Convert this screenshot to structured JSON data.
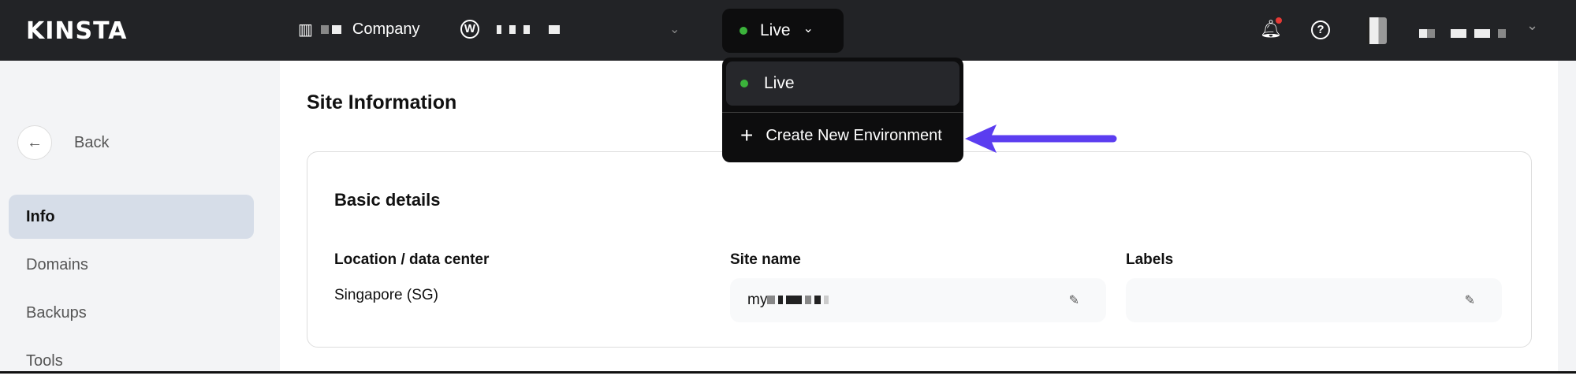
{
  "header": {
    "logo": "KINSTA",
    "company": "Company",
    "live_label": "Live",
    "user_menu_chevron": "⌄"
  },
  "dropdown": {
    "live": "Live",
    "create": "Create New Environment"
  },
  "sidebar": {
    "back": "Back",
    "items": [
      {
        "label": "Info"
      },
      {
        "label": "Domains"
      },
      {
        "label": "Backups"
      },
      {
        "label": "Tools"
      }
    ]
  },
  "main": {
    "title": "Site Information",
    "card_title": "Basic details",
    "location_label": "Location / data center",
    "location_value": "Singapore (SG)",
    "site_name_label": "Site name",
    "site_name_value": "my",
    "labels_label": "Labels"
  },
  "colors": {
    "header": "#222326",
    "accent_arrow": "#5b3df0",
    "live_dot": "#3bb33b"
  }
}
